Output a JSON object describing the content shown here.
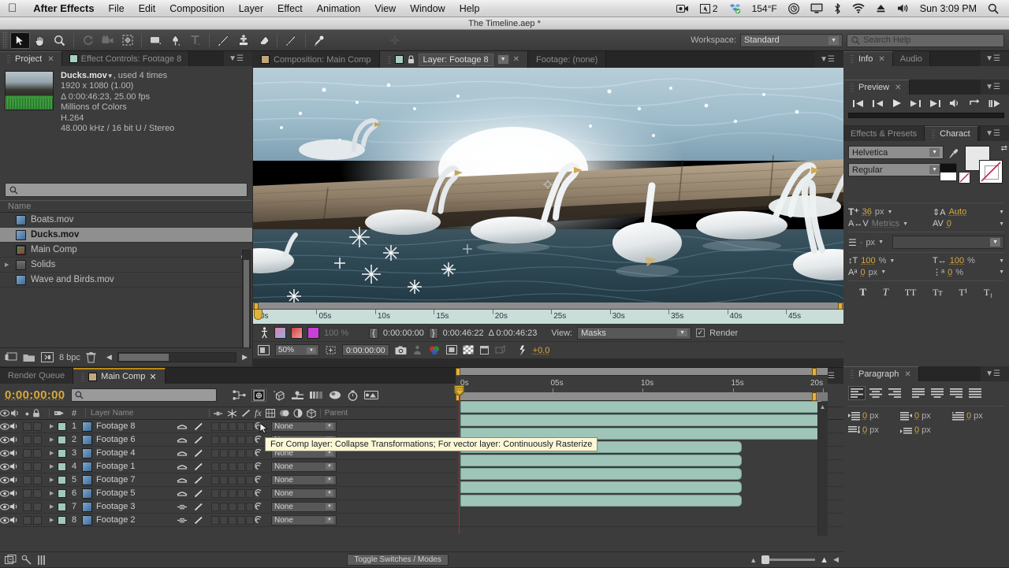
{
  "os_menu": {
    "apple_icon": "apple-logo",
    "items": [
      "After Effects",
      "File",
      "Edit",
      "Composition",
      "Layer",
      "Effect",
      "Animation",
      "View",
      "Window",
      "Help"
    ],
    "status_items": [
      {
        "name": "screen-recording-icon",
        "label": ""
      },
      {
        "name": "adobe-app-icon",
        "label": "2"
      },
      {
        "name": "dropbox-icon",
        "label": ""
      },
      {
        "name": "temperature-icon",
        "label": "154°F"
      },
      {
        "name": "timemachine-icon",
        "label": ""
      },
      {
        "name": "display-icon",
        "label": ""
      },
      {
        "name": "bluetooth-icon",
        "label": ""
      },
      {
        "name": "wifi-icon",
        "label": ""
      },
      {
        "name": "eject-icon",
        "label": ""
      },
      {
        "name": "volume-icon",
        "label": ""
      }
    ],
    "clock": "Sun 3:09 PM",
    "spotlight": "search-icon"
  },
  "title_bar": {
    "document_title": "The Timeline.aep *"
  },
  "toolbar": {
    "tools": [
      {
        "name": "selection-tool",
        "active": true
      },
      {
        "name": "hand-tool",
        "active": false
      },
      {
        "name": "zoom-tool",
        "active": false
      },
      {
        "name": "rotation-tool",
        "active": false
      },
      {
        "name": "camera-tool",
        "active": false
      },
      {
        "name": "pan-behind-tool",
        "active": false
      },
      {
        "name": "shape-tool",
        "active": false
      },
      {
        "name": "pen-tool",
        "active": false
      },
      {
        "name": "type-tool",
        "active": false
      },
      {
        "name": "brush-tool",
        "active": false
      },
      {
        "name": "clone-stamp-tool",
        "active": false
      },
      {
        "name": "eraser-tool",
        "active": false
      },
      {
        "name": "roto-brush-tool",
        "active": false
      },
      {
        "name": "puppet-pin-tool",
        "active": false
      }
    ],
    "workspace_label": "Workspace:",
    "workspace_value": "Standard",
    "search_help_placeholder": "Search Help"
  },
  "project_panel": {
    "tabs": [
      {
        "label": "Project",
        "active": true,
        "closable": true
      },
      {
        "label": "Effect Controls: Footage 8",
        "active": false,
        "closable": false
      }
    ],
    "selected_asset": {
      "name": "Ducks.mov",
      "usage": ", used 4 times",
      "dimensions": "1920 x 1080 (1.00)",
      "duration": "Δ 0:00:46:23, 25.00 fps",
      "color_depth": "Millions of Colors",
      "codec": "H.264",
      "audio": "48.000 kHz / 16 bit U / Stereo"
    },
    "search_placeholder": "",
    "column_header": "Name",
    "items": [
      {
        "label": "Boats.mov",
        "type": "footage",
        "selected": false,
        "expandable": false
      },
      {
        "label": "Ducks.mov",
        "type": "footage",
        "selected": true,
        "expandable": false
      },
      {
        "label": "Main Comp",
        "type": "composition",
        "selected": false,
        "expandable": false
      },
      {
        "label": "Solids",
        "type": "folder",
        "selected": false,
        "expandable": true
      },
      {
        "label": "Wave and Birds.mov",
        "type": "footage",
        "selected": false,
        "expandable": false
      }
    ],
    "footer": {
      "bit_depth": "8 bpc",
      "buttons": [
        "new-comp-icon",
        "new-folder-icon",
        "project-settings-icon",
        "delete-icon"
      ]
    }
  },
  "viewer_panel": {
    "tabs": [
      {
        "label": "Composition: Main Comp",
        "active": false,
        "swatch": "#c0a87e"
      },
      {
        "label": "Layer: Footage 8",
        "active": true,
        "swatch": "#a8cfc4"
      },
      {
        "label": "Footage: (none)",
        "active": false,
        "swatch": ""
      }
    ],
    "ruler_labels": [
      "0s",
      "05s",
      "10s",
      "15s",
      "20s",
      "25s",
      "30s",
      "35s",
      "40s",
      "45s"
    ],
    "controls": {
      "opacity": "100 %",
      "in_point": "0:00:00:00",
      "out_point": "0:00:46:22",
      "duration": "Δ 0:00:46:23",
      "view_label": "View:",
      "view_value": "Masks",
      "render_label": "Render",
      "render_checked": true
    },
    "bottom_bar": {
      "zoom": "50%",
      "timecode": "0:00:00:00",
      "exposure": "+0.0"
    }
  },
  "info_panel": {
    "tabs": [
      {
        "label": "Info",
        "active": true
      },
      {
        "label": "Audio",
        "active": false
      }
    ]
  },
  "preview_panel": {
    "tabs": [
      {
        "label": "Preview",
        "active": true
      }
    ],
    "transport": [
      "first-frame-icon",
      "previous-frame-icon",
      "play-icon",
      "next-frame-icon",
      "last-frame-icon",
      "audio-icon",
      "loop-icon",
      "ram-preview-icon"
    ]
  },
  "character_panel": {
    "tabs": [
      {
        "label": "Effects & Presets",
        "active": false
      },
      {
        "label": "Charact",
        "active": true
      }
    ],
    "font_family": "Helvetica",
    "font_style": "Regular",
    "font_size": "36",
    "font_size_unit": "px",
    "leading": "Auto",
    "kerning": "Metrics",
    "tracking": "0",
    "stroke_width": "-",
    "stroke_width_unit": "px",
    "stroke_style": "",
    "vertical_scale": "100",
    "horizontal_scale": "100",
    "baseline_shift": "0",
    "baseline_shift_unit": "px",
    "tsume": "0",
    "tsume_unit": "%",
    "percent": "%",
    "style_buttons": [
      "T",
      "T",
      "TT",
      "Tᴛ",
      "T¹",
      "T₁"
    ]
  },
  "paragraph_panel": {
    "tabs": [
      {
        "label": "Paragraph",
        "active": true
      }
    ],
    "align_buttons": [
      "align-left-icon",
      "align-center-icon",
      "align-right-icon",
      "justify-last-left-icon",
      "justify-last-center-icon",
      "justify-last-right-icon",
      "justify-all-icon"
    ],
    "indents": [
      {
        "name": "indent-left-margin",
        "value": "0",
        "unit": "px"
      },
      {
        "name": "indent-right-margin",
        "value": "0",
        "unit": "px"
      },
      {
        "name": "indent-first-line",
        "value": "0",
        "unit": "px"
      },
      {
        "name": "space-before-paragraph",
        "value": "0",
        "unit": "px"
      },
      {
        "name": "space-after-paragraph",
        "value": "0",
        "unit": "px"
      }
    ]
  },
  "timeline_panel": {
    "tabs": [
      {
        "label": "Render Queue",
        "active": false,
        "closable": false
      },
      {
        "label": "Main Comp",
        "active": true,
        "closable": true
      }
    ],
    "current_time": "0:00:00:00",
    "search_placeholder": "",
    "column_headers": {
      "layer_name": "Layer Name",
      "parent": "Parent"
    },
    "switch_icons": [
      "shy-icon",
      "collapse-transformations-icon",
      "quality-icon",
      "effects-icon",
      "frame-blending-icon",
      "motion-blur-icon",
      "adjustment-layer-icon",
      "3d-layer-icon"
    ],
    "ruler_labels": [
      "0s",
      "05s",
      "10s",
      "15s",
      "20s"
    ],
    "layers": [
      {
        "index": "1",
        "name": "Footage 8",
        "parent": "None",
        "bar_start_pct": 0,
        "bar_end_pct": 100,
        "blend_icon": "motion-blur"
      },
      {
        "index": "2",
        "name": "Footage 6",
        "parent": "None",
        "bar_start_pct": 0,
        "bar_end_pct": 100,
        "blend_icon": "motion-blur"
      },
      {
        "index": "3",
        "name": "Footage 4",
        "parent": "None",
        "bar_start_pct": 0,
        "bar_end_pct": 100,
        "blend_icon": "motion-blur"
      },
      {
        "index": "4",
        "name": "Footage 1",
        "parent": "None",
        "bar_start_pct": 0,
        "bar_end_pct": 78,
        "blend_icon": "motion-blur"
      },
      {
        "index": "5",
        "name": "Footage 7",
        "parent": "None",
        "bar_start_pct": 0,
        "bar_end_pct": 78,
        "blend_icon": "motion-blur"
      },
      {
        "index": "6",
        "name": "Footage 5",
        "parent": "None",
        "bar_start_pct": 0,
        "bar_end_pct": 78,
        "blend_icon": "motion-blur"
      },
      {
        "index": "7",
        "name": "Footage 3",
        "parent": "None",
        "bar_start_pct": 0,
        "bar_end_pct": 78,
        "blend_icon": "pan-behind"
      },
      {
        "index": "8",
        "name": "Footage 2",
        "parent": "None",
        "bar_start_pct": 0,
        "bar_end_pct": 78,
        "blend_icon": "pan-behind"
      }
    ],
    "tooltip": "For Comp layer: Collapse Transformations; For vector layer: Continuously Rasterize",
    "footer_button": "Toggle Switches / Modes"
  },
  "colors": {
    "panel_bg": "#3c3c3c",
    "panel_dark": "#2b2b2b",
    "accent_orange": "#d8a93c",
    "layer_bar": "#9fc4b8",
    "cti_red": "#c4242a",
    "timeline_ruler": "#c9ddd9"
  }
}
